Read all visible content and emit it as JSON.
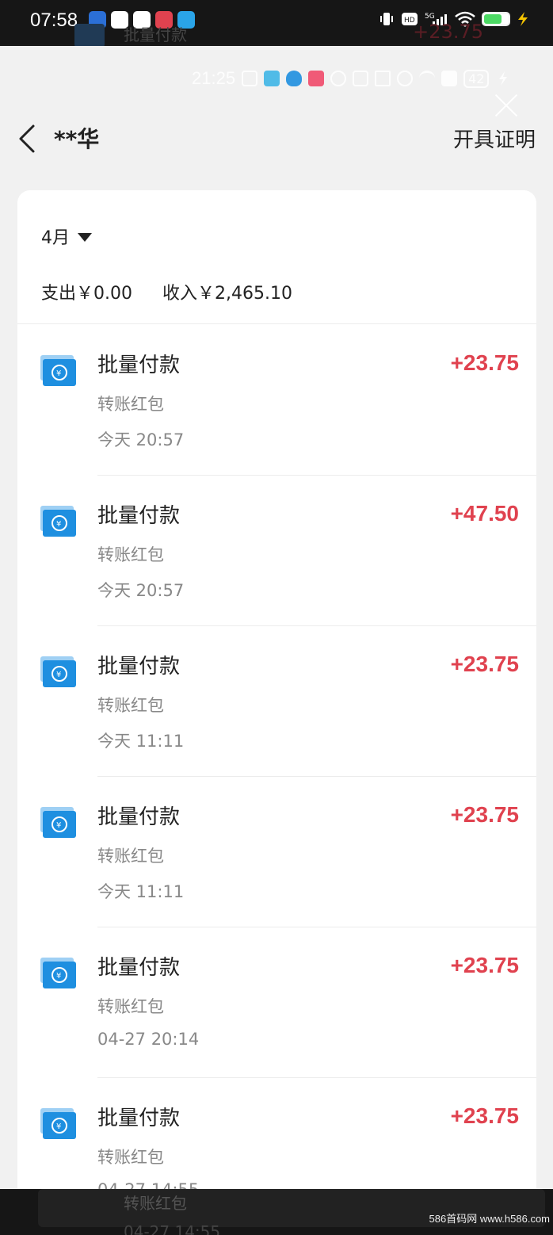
{
  "status_bar": {
    "time": "07:58",
    "app_icon_colors": [
      "#2b6fd6",
      "#ffffff",
      "#ffffff",
      "#e0424f",
      "#2aa4e8"
    ],
    "right_icons": [
      "vibrate-icon",
      "hd-icon",
      "5g-signal-icon",
      "wifi-icon",
      "battery-icon",
      "charging-icon"
    ]
  },
  "background_ghost": {
    "title": "批量付款",
    "amount": "+23.75"
  },
  "inner_status": {
    "time": "21:25",
    "battery": "42"
  },
  "nav": {
    "title": "**华",
    "action": "开具证明"
  },
  "summary": {
    "month": "4月",
    "expense": "支出￥0.00",
    "income": "收入￥2,465.10"
  },
  "transactions": [
    {
      "title": "批量付款",
      "subtitle": "转账红包",
      "time": "今天 20:57",
      "amount": "+23.75"
    },
    {
      "title": "批量付款",
      "subtitle": "转账红包",
      "time": "今天 20:57",
      "amount": "+47.50"
    },
    {
      "title": "批量付款",
      "subtitle": "转账红包",
      "time": "今天 11:11",
      "amount": "+23.75"
    },
    {
      "title": "批量付款",
      "subtitle": "转账红包",
      "time": "今天 11:11",
      "amount": "+23.75"
    },
    {
      "title": "批量付款",
      "subtitle": "转账红包",
      "time": "04-27 20:14",
      "amount": "+23.75"
    },
    {
      "title": "批量付款",
      "subtitle": "转账红包",
      "time": "04-27 14:55",
      "amount": "+23.75"
    }
  ],
  "bottom_ghost": {
    "subtitle": "转账红包",
    "time": "04-27 14:55"
  },
  "watermark": "586首码网 www.h586.com",
  "colors": {
    "amount": "#e0424f",
    "icon_blue": "#1e8fe0",
    "sheet_bg": "#f1f1f1"
  }
}
